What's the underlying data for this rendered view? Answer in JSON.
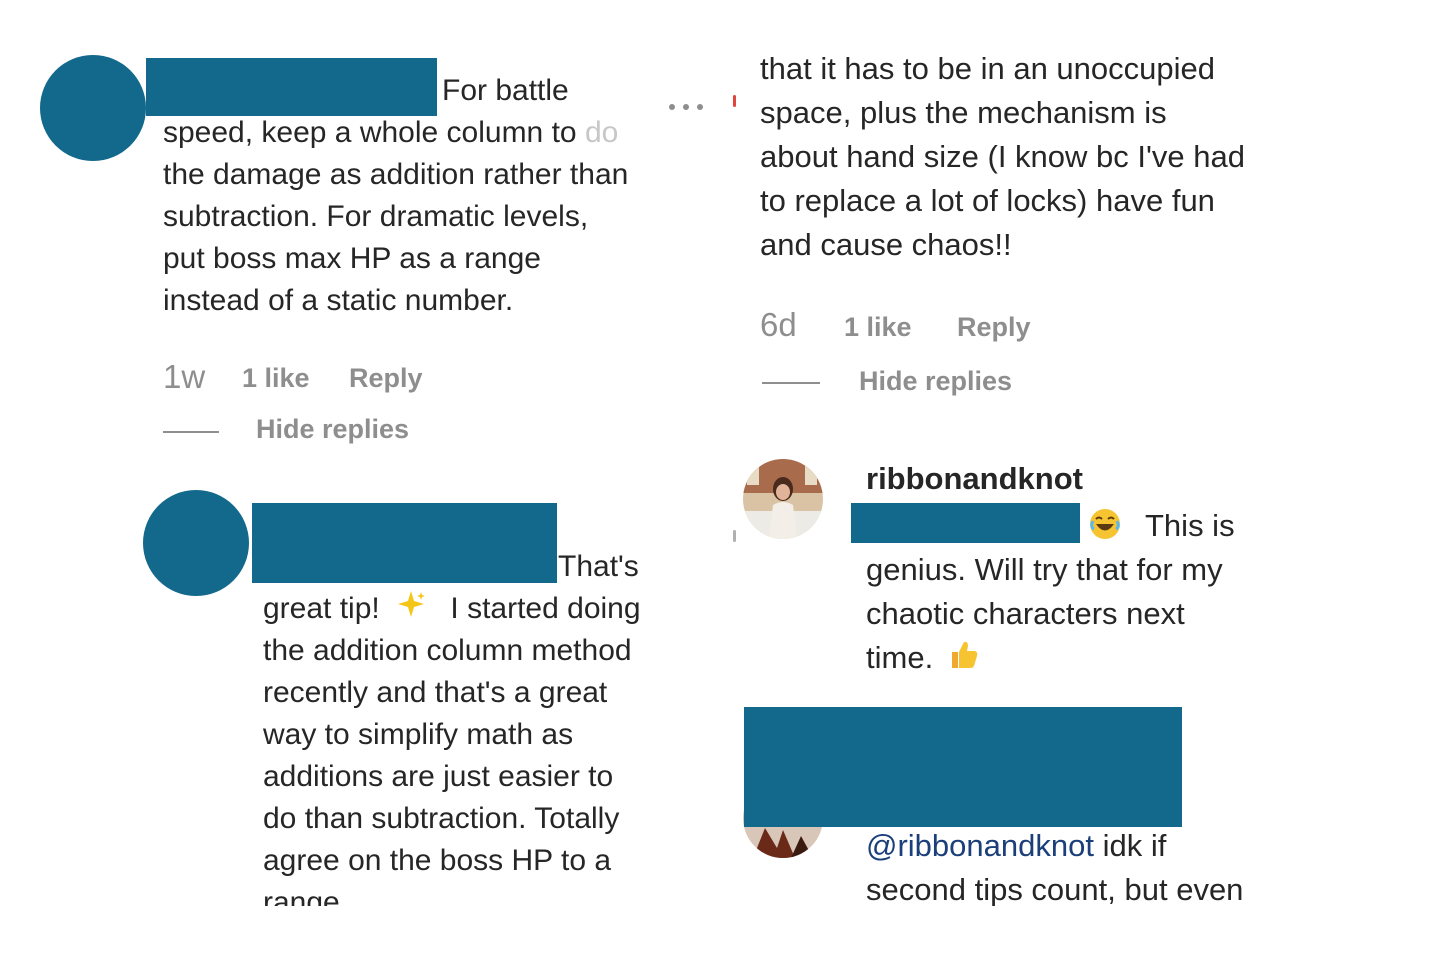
{
  "left_comment": {
    "lines": [
      "For battle",
      "speed, keep a whole column to",
      "do",
      "the damage as addition rather than",
      "subtraction. For dramatic levels,",
      "put boss max HP as a range",
      "instead of a static number."
    ],
    "time": "1w",
    "likes": "1 like",
    "reply": "Reply",
    "hide_replies": "Hide replies",
    "more_icon": "more-horizontal-icon"
  },
  "left_reply": {
    "line1": "That's",
    "line2_a": "great tip!",
    "line2_b": "I started doing",
    "lines": [
      "the addition column method",
      "recently and that's a great",
      "way to simplify math as",
      "additions are just easier to",
      "do than subtraction. Totally",
      "agree on the boss HP to a",
      "range"
    ],
    "emoji_sparkles": "✨"
  },
  "right_comment": {
    "lines": [
      "that it has to be in an unoccupied",
      "space, plus the mechanism is",
      "about hand size (I know bc I've had",
      "to replace a lot of locks) have fun",
      "and cause chaos!!"
    ],
    "time": "6d",
    "likes": "1 like",
    "reply": "Reply",
    "hide_replies": "Hide replies"
  },
  "right_reply": {
    "username": "ribbonandknot",
    "emoji_laugh": "😂",
    "line1": "This is",
    "lines": [
      "genius. Will try that for my",
      "chaotic characters next"
    ],
    "last_line": "time.",
    "emoji_thumbs": "👍"
  },
  "right_reply2": {
    "mention": "@ribbonandknot",
    "line1_rest": " idk if",
    "line2": "second tips count, but even"
  },
  "colors": {
    "redaction": "#12698c",
    "text": "#262626",
    "meta": "#8e8e8e",
    "mention": "#1b3f7a"
  }
}
